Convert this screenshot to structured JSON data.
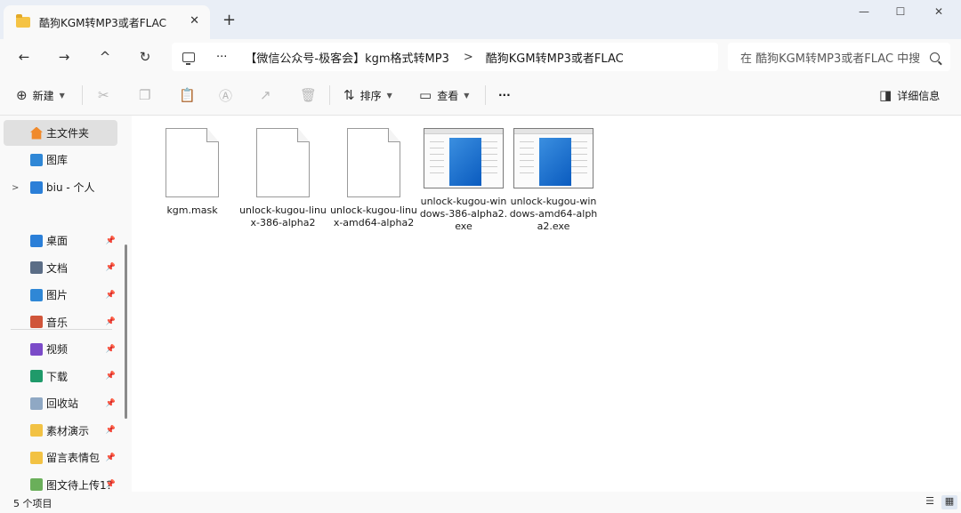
{
  "tab": {
    "title": "酷狗KGM转MP3或者FLAC",
    "close": "✕",
    "new_tab": "+"
  },
  "window": {
    "minimize": "—",
    "maximize": "☐",
    "close": "✕"
  },
  "nav": {
    "back": "←",
    "forward": "→",
    "up": "^",
    "refresh": "↻",
    "more": "···",
    "path": [
      "【微信公众号-极客会】kgm格式转MP3",
      "酷狗KGM转MP3或者FLAC"
    ],
    "separator": ">",
    "search_placeholder": "在 酷狗KGM转MP3或者FLAC 中搜"
  },
  "toolbar": {
    "new_label": "新建",
    "sort_label": "排序",
    "view_label": "查看",
    "more_label": "···",
    "details_label": "详细信息"
  },
  "sidebar": {
    "home": "主文件夹",
    "gallery": "图库",
    "personal": "biu - 个人",
    "pinned": [
      {
        "label": "桌面",
        "color": "#2b7fd8"
      },
      {
        "label": "文档",
        "color": "#5b6d86"
      },
      {
        "label": "图片",
        "color": "#2f87d6"
      },
      {
        "label": "音乐",
        "color": "#d0553a"
      },
      {
        "label": "视频",
        "color": "#7b4bc8"
      },
      {
        "label": "下载",
        "color": "#1f9a6a"
      },
      {
        "label": "回收站",
        "color": "#8fa8c4"
      },
      {
        "label": "素材演示",
        "color": "#f2c244"
      },
      {
        "label": "留言表情包",
        "color": "#f2c244"
      },
      {
        "label": "图文待上传1？",
        "color": "#6aaf5a"
      }
    ]
  },
  "files": [
    {
      "name": "kgm.mask",
      "type": "doc"
    },
    {
      "name": "unlock-kugou-linux-386-alpha2",
      "type": "doc"
    },
    {
      "name": "unlock-kugou-linux-amd64-alpha2",
      "type": "doc"
    },
    {
      "name": "unlock-kugou-windows-386-alpha2.exe",
      "type": "exe"
    },
    {
      "name": "unlock-kugou-windows-amd64-alpha2.exe",
      "type": "exe"
    }
  ],
  "status": {
    "count": "5 个项目"
  }
}
